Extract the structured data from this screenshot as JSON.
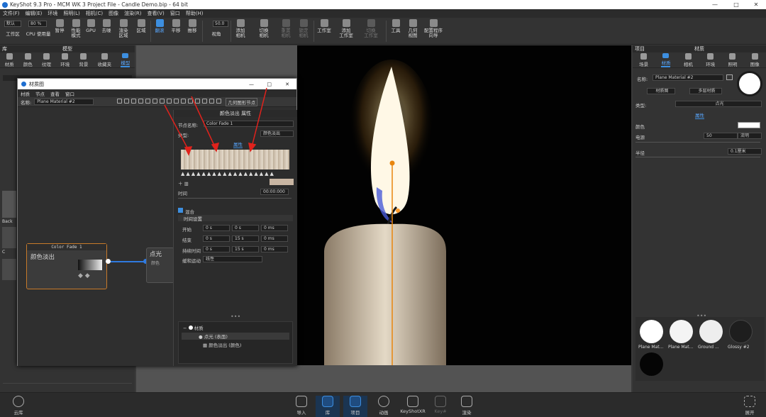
{
  "window": {
    "title": "KeyShot 9.3 Pro  -  MCM WK 3 Project File - Candle Demo.bip  - 64 bit",
    "controls": [
      "—",
      "□",
      "✕"
    ]
  },
  "menu": [
    "文件(F)",
    "编辑(E)",
    "环境",
    "照明(L)",
    "相机(C)",
    "图像",
    "渲染(R)",
    "查看(V)",
    "窗口",
    "帮助(H)"
  ],
  "ribbon": {
    "workspace_value": "默认",
    "cpu_value": "80 %",
    "zoom_value": "50.0",
    "buttons": [
      "工作区",
      "CPU 使用量",
      "暂停",
      "性能\n模式",
      "GPU",
      "去噪",
      "渲染\n区域",
      "区域",
      "翻滚",
      "平移",
      "推移",
      "视角",
      "添加\n相机",
      "切换\n相机",
      "重置\n相机",
      "锁定\n相机",
      "工作室",
      "添加\n工作室",
      "切换\n工作室",
      "工具",
      "几何\n视图",
      "配置程序\n向导"
    ]
  },
  "left_panel": {
    "title": "库",
    "subtitle": "模型",
    "tabs": [
      "材质",
      "颜色",
      "纹理",
      "环境",
      "背景",
      "收藏夹",
      "模型"
    ],
    "thumbs_partial": [
      "Back",
      "C"
    ]
  },
  "material_window": {
    "title": "材质图",
    "menu": [
      "材质",
      "节点",
      "查看",
      "窗口"
    ],
    "name_label": "名称:",
    "name_value": "Plane Material #2",
    "add_node_label": "几何图形节点",
    "node_a": {
      "header": "Color Fade 1",
      "label": "颜色淡出"
    },
    "node_b": {
      "label": "点光",
      "sub": "颜色"
    },
    "props": {
      "header": "颜色淡出 属性",
      "node_name_label": "节点名称:",
      "node_name_value": "Color Fade 1",
      "type_label": "类型:",
      "type_value": "颜色淡出",
      "tab": "属性",
      "time_label": "时间",
      "time_value": "00:00:000",
      "mix_label": "混合",
      "timing_header": "时间设置",
      "timing": [
        {
          "label": "开始",
          "v": [
            "0 s",
            "0 s",
            "0 ms"
          ]
        },
        {
          "label": "结束",
          "v": [
            "0 s",
            "15 s",
            "0 ms"
          ]
        },
        {
          "label": "持续时间",
          "v": [
            "0 s",
            "15 s",
            "0 ms"
          ]
        }
      ],
      "motion_label": "缓和运动",
      "motion_value": "线性",
      "tree": [
        "材质",
        "点光 (表面)",
        "颜色淡出 (颜色)"
      ]
    }
  },
  "right_panel": {
    "title": "项目",
    "subtitle": "材质",
    "tabs": [
      "场景",
      "材质",
      "相机",
      "环境",
      "照明",
      "图像"
    ],
    "name_label": "名称:",
    "name_value": "Plane Material #2",
    "mat_graph_btn": "材质图",
    "multi_btn": "多层材质",
    "type_label": "类型:",
    "type_value": "点光",
    "tab": "属性",
    "color_label": "颜色",
    "power_label": "电源",
    "power_value": "50",
    "power_unit": "流明",
    "radius_label": "半径",
    "radius_value": "0.1厘米",
    "materials": [
      {
        "name": "Plane Mat...",
        "color": "#ffffff"
      },
      {
        "name": "Plane Mat...",
        "color": "#f4f4f4"
      },
      {
        "name": "Ground ...",
        "color": "#eeeeee"
      },
      {
        "name": "Glossy #2",
        "color": "#1e1e1e"
      },
      {
        "name": "",
        "color": "#050505"
      }
    ]
  },
  "bottom": {
    "cloud": "云库",
    "buttons": [
      "导入",
      "库",
      "项目",
      "动画",
      "KeyShotXR",
      "Key#",
      "渲染"
    ],
    "expand": "展开"
  },
  "colors": {
    "accent": "#3d8fe0",
    "node_border": "#c77a2a",
    "arrow": "#e0221c"
  }
}
